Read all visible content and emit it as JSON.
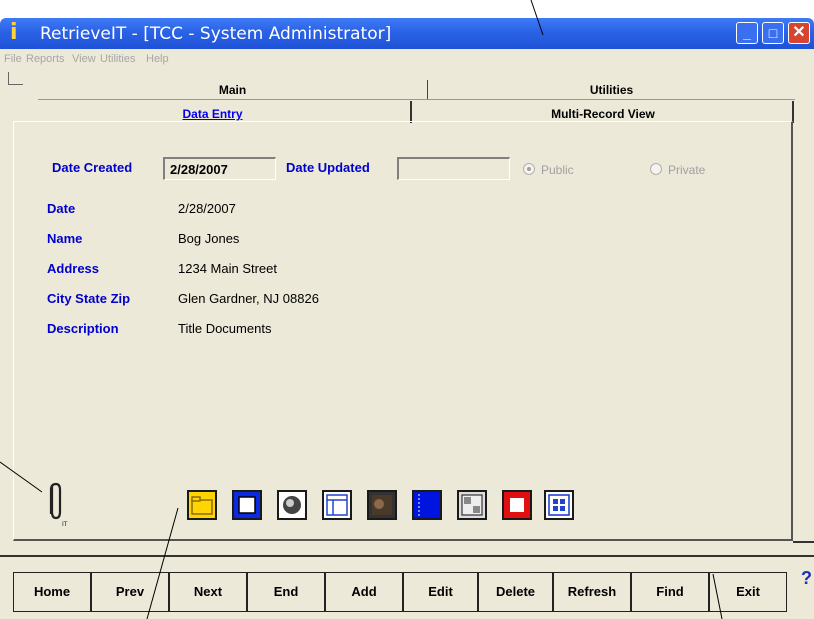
{
  "window": {
    "title": "RetrieveIT - [TCC  - System Administrator]",
    "icon": "retrieveit-app-icon",
    "controls": [
      "minimize",
      "maximize",
      "close"
    ]
  },
  "menu": [
    "File",
    "Reports",
    "View",
    "Utilities",
    "Help"
  ],
  "tabs": {
    "main": "Main",
    "utilities": "Utilities",
    "data_entry": "Data Entry",
    "multi_record": "Multi-Record View",
    "active": "Data Entry"
  },
  "form": {
    "date_created_label": "Date Created",
    "date_created_value": "2/28/2007",
    "date_updated_label": "Date Updated",
    "date_updated_value": "",
    "public_label": "Public",
    "private_label": "Private",
    "public_selected": true,
    "fields": [
      {
        "label": "Date",
        "value": "2/28/2007"
      },
      {
        "label": "Name",
        "value": "Bog Jones"
      },
      {
        "label": "Address",
        "value": "1234 Main Street"
      },
      {
        "label": "City State Zip",
        "value": "Glen Gardner, NJ 08826"
      },
      {
        "label": "Description",
        "value": "Title Documents"
      }
    ]
  },
  "attachment_icon": "paperclip-icon",
  "toolbar_icons": [
    "folder-icon",
    "blue-frame-icon",
    "lens-icon",
    "layout-icon",
    "image-icon",
    "blue-book-icon",
    "scanner-icon",
    "red-frame-icon",
    "grid-icon"
  ],
  "nav_buttons": [
    "Home",
    "Prev",
    "Next",
    "End",
    "Add",
    "Edit",
    "Delete",
    "Refresh",
    "Find",
    "Exit"
  ],
  "help": "?"
}
